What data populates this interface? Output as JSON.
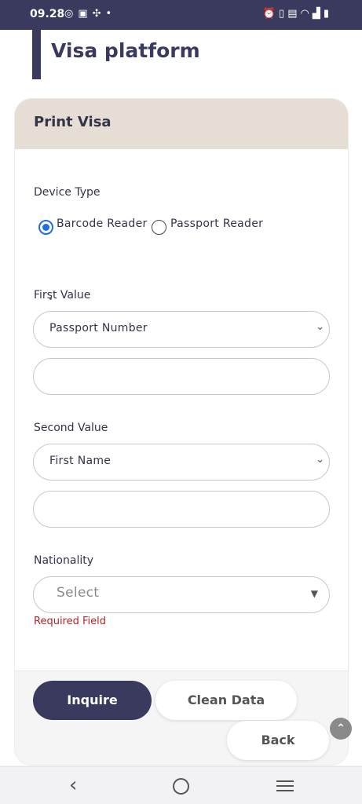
{
  "status_bar": {
    "time": "09.28",
    "left_icons": [
      "instagram-icon",
      "bag-icon",
      "pinwheel-icon",
      "dot-icon"
    ],
    "right_icons": [
      "alarm-icon",
      "vibrate-icon",
      "volte-icon",
      "wifi-icon",
      "signal-icon",
      "battery-icon"
    ]
  },
  "page": {
    "title": "Visa platform",
    "accent_color": "#3a3a5e"
  },
  "form": {
    "title": "Print Visa",
    "header_color": "#e6ddd4",
    "device_type": {
      "label": "Device Type",
      "options": [
        {
          "label": "Barcode Reader",
          "selected": true
        },
        {
          "label": "Passport Reader",
          "selected": false
        }
      ],
      "hint": "."
    },
    "first_value": {
      "label": "First Value",
      "select_value": "Passport Number",
      "input_value": ""
    },
    "second_value": {
      "label": "Second Value",
      "select_value": "First Name",
      "input_value": ""
    },
    "nationality": {
      "label": "Nationality",
      "select_value": "Select",
      "error": "Required Field",
      "error_color": "#b0252a"
    }
  },
  "actions": {
    "inquire": "Inquire",
    "clean": "Clean Data",
    "back": "Back"
  },
  "nav": {
    "icons": [
      "back-icon",
      "home-icon",
      "recents-icon"
    ]
  }
}
